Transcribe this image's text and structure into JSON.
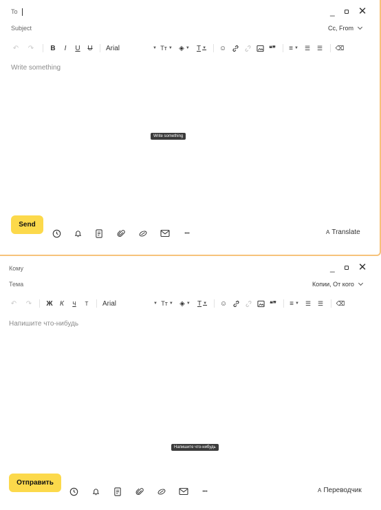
{
  "composers": [
    {
      "to_label": "To",
      "subject_label": "Subject",
      "cc_from_label": "Cc, From",
      "font_name": "Arial",
      "body_placeholder": "Write something",
      "tooltip": "Write something",
      "send_label": "Send",
      "translate_label": "Translate",
      "format_buttons": {
        "bold": "B",
        "italic": "I",
        "underline": "U",
        "strike": "U"
      }
    },
    {
      "to_label": "Кому",
      "subject_label": "Тема",
      "cc_from_label": "Копии, От кого",
      "font_name": "Arial",
      "body_placeholder": "Напишите что-нибудь",
      "tooltip": "Напишите что-нибудь",
      "send_label": "Отправить",
      "translate_label": "Переводчик",
      "format_buttons": {
        "bold": "Ж",
        "italic": "К",
        "underline": "Ч",
        "strike": "Т"
      }
    }
  ],
  "toolbar_glyphs": {
    "undo": "↶",
    "redo": "↷",
    "text_size": "Tт",
    "fill": "◈",
    "text_color": "T",
    "emoji": "☺",
    "quote": "❝❞",
    "align": "≡",
    "bullets": "☰",
    "numbers": "☰",
    "eraser": "⌫"
  },
  "window_glyphs": {
    "minimize": "_",
    "close": "✕"
  },
  "bottom_glyphs": {
    "more": "•••",
    "translate_icon": "A"
  },
  "colors": {
    "send_button": "#fcd94b",
    "tooltip_bg": "#3b3b3b",
    "placeholder": "#8b8b8b",
    "frame_accent": "#f6c27a"
  }
}
